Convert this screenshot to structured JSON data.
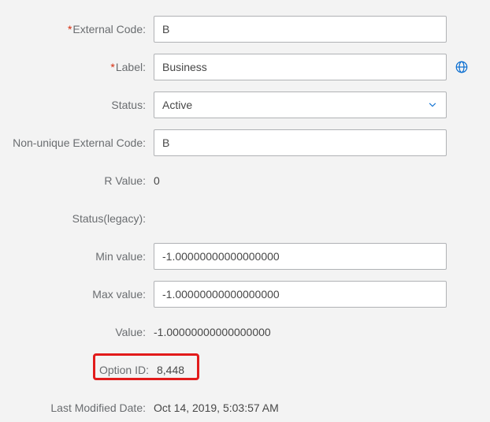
{
  "form": {
    "external_code": {
      "label": "External Code:",
      "value": "B"
    },
    "label_field": {
      "label": "Label:",
      "value": "Business"
    },
    "status": {
      "label": "Status:",
      "value": "Active"
    },
    "non_unique_external_code": {
      "label": "Non-unique External Code:",
      "value": "B"
    },
    "r_value": {
      "label": "R Value:",
      "value": "0"
    },
    "status_legacy": {
      "label": "Status(legacy):",
      "value": ""
    },
    "min_value": {
      "label": "Min value:",
      "value": "-1.00000000000000000"
    },
    "max_value": {
      "label": "Max value:",
      "value": "-1.00000000000000000"
    },
    "value": {
      "label": "Value:",
      "value": "-1.00000000000000000"
    },
    "option_id": {
      "label": "Option ID:",
      "value": "8,448"
    },
    "last_modified": {
      "label": "Last Modified Date:",
      "value": "Oct 14, 2019, 5:03:57 AM"
    }
  }
}
